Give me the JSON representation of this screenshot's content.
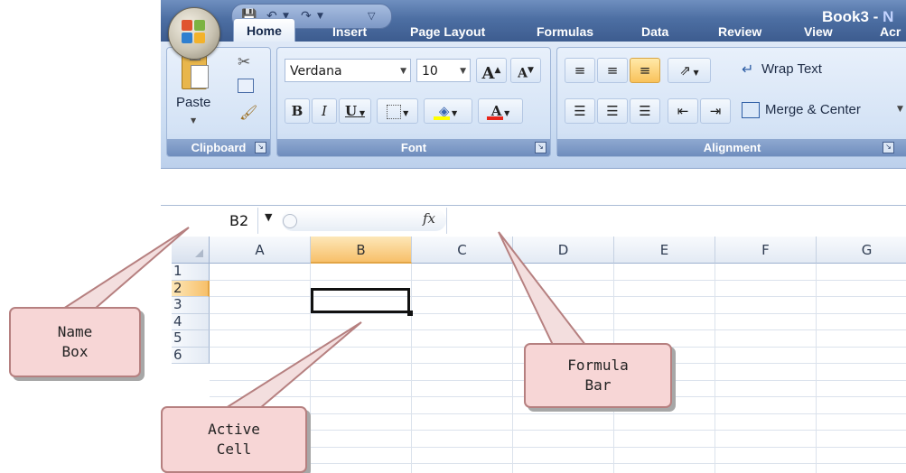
{
  "window": {
    "title_main": "Book3 - ",
    "title_accent": "N"
  },
  "tabs": [
    "Home",
    "Insert",
    "Page Layout",
    "Formulas",
    "Data",
    "Review",
    "View",
    "Acr"
  ],
  "ribbon": {
    "clipboard": {
      "paste_label": "Paste",
      "group_label": "Clipboard"
    },
    "font": {
      "font_name": "Verdana",
      "font_size": "10",
      "group_label": "Font",
      "grow_font": "A",
      "shrink_font": "A",
      "bold": "B",
      "italic": "I",
      "underline": "U",
      "font_color": "A"
    },
    "alignment": {
      "wrap_text": "Wrap Text",
      "merge_center": "Merge & Center",
      "group_label": "Alignment"
    }
  },
  "formula_bar": {
    "name_box_value": "B2",
    "fx_label": "fx",
    "formula_value": ""
  },
  "grid": {
    "columns": [
      "A",
      "B",
      "C",
      "D",
      "E",
      "F",
      "G"
    ],
    "rows": [
      "1",
      "2",
      "3",
      "4",
      "5",
      "6"
    ],
    "selected_column": "B",
    "selected_row": "2",
    "active_cell": "B2"
  },
  "callouts": {
    "name_box": "Name\nBox",
    "active_cell": "Active\nCell",
    "formula_bar": "Formula\nBar"
  },
  "colors": {
    "title_bar": "#4d6fa3",
    "selection_highlight": "#f7c06a",
    "callout_fill": "#f7d6d6",
    "callout_border": "#b68080"
  }
}
